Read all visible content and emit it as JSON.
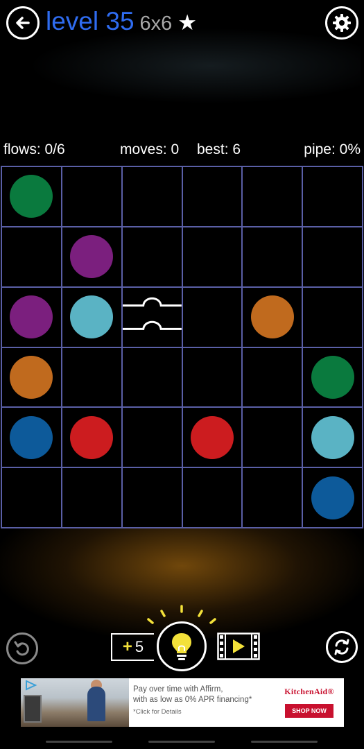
{
  "header": {
    "level_label": "level 35",
    "size_label": "6x6",
    "star_glyph": "★",
    "back_icon": "arrow-left-circle",
    "settings_icon": "gear"
  },
  "stats": {
    "flows": "flows: 0/6",
    "moves": "moves: 0",
    "best": "best: 6",
    "pipe": "pipe: 0%"
  },
  "board": {
    "rows": 6,
    "cols": 6,
    "grid_color": "#5a5fa6",
    "colors": {
      "green": "#0a7a3e",
      "purple": "#7b1f7e",
      "cyan": "#5ab3c4",
      "orange": "#c06a1e",
      "blue": "#0d5a9a",
      "red": "#cc1c1f"
    },
    "cells": [
      [
        "green",
        "",
        "",
        "",
        "",
        ""
      ],
      [
        "",
        "purple",
        "",
        "",
        "",
        ""
      ],
      [
        "purple",
        "cyan",
        "bridge",
        "",
        "orange",
        ""
      ],
      [
        "orange",
        "",
        "",
        "",
        "",
        "green"
      ],
      [
        "blue",
        "red",
        "",
        "red",
        "",
        "cyan"
      ],
      [
        "",
        "",
        "",
        "",
        "",
        "blue"
      ]
    ]
  },
  "controls": {
    "undo_icon": "undo",
    "hint_plus": "+",
    "hint_count": "5",
    "hint_icon": "lightbulb",
    "video_icon": "film-play",
    "reset_icon": "refresh",
    "accent": "#f3e13a"
  },
  "ad": {
    "line1": "Pay over time with Affirm,",
    "line2": "with as low as 0% APR financing*",
    "line3": "*Click for Details",
    "brand": "KitchenAid®",
    "cta": "SHOP NOW",
    "brand_color": "#c8102e"
  }
}
